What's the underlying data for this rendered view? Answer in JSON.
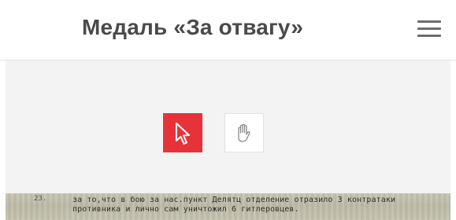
{
  "header": {
    "title": "Медаль «За отвагу»",
    "menu_icon": "hamburger-menu-icon"
  },
  "viewer": {
    "tools": [
      {
        "name": "select",
        "icon": "cursor-arrow-icon",
        "active": true,
        "color": "#e8323a"
      },
      {
        "name": "pan",
        "icon": "hand-icon",
        "active": false
      }
    ],
    "document": {
      "number": "23.",
      "lines": [
        "за то,что в бою за нас.пункт Делятц отделение отразило 3 контратаки",
        "противника и лично сам уничтожил 6 гитлеровцев."
      ]
    }
  }
}
